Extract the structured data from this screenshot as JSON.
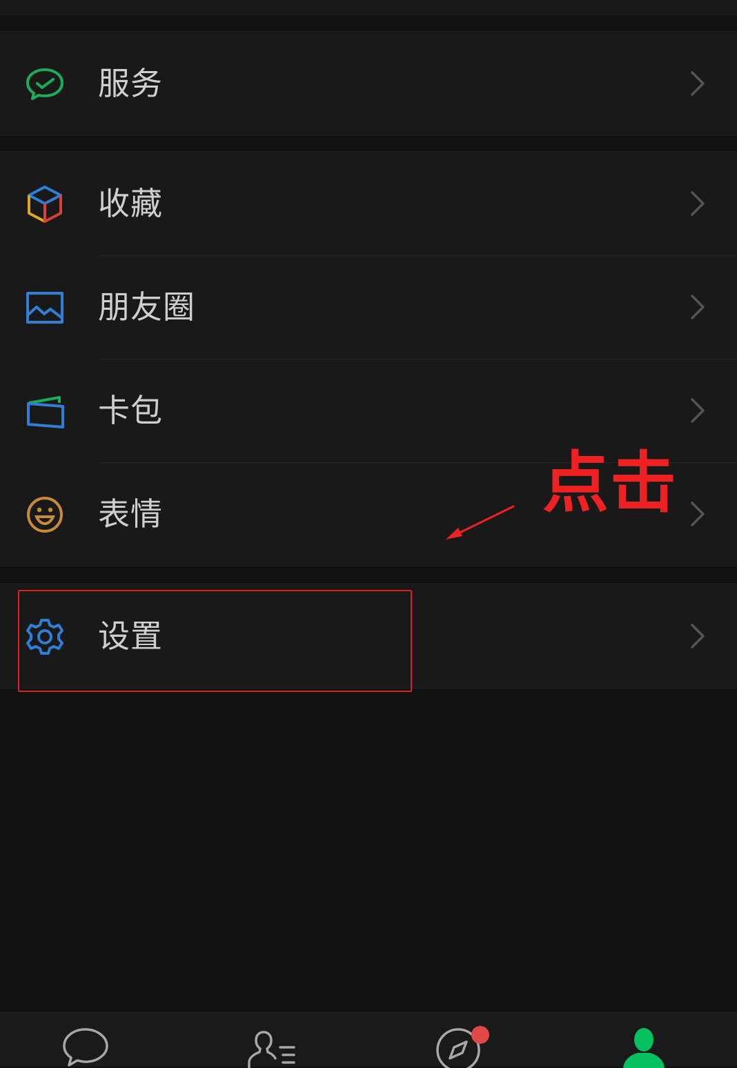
{
  "menu": {
    "services": {
      "label": "服务",
      "icon": "wechat-pay-icon"
    },
    "favorites": {
      "label": "收藏",
      "icon": "cube-icon"
    },
    "moments": {
      "label": "朋友圈",
      "icon": "picture-icon"
    },
    "cards": {
      "label": "卡包",
      "icon": "wallet-icon"
    },
    "stickers": {
      "label": "表情",
      "icon": "smiley-icon"
    },
    "settings": {
      "label": "设置",
      "icon": "gear-icon"
    }
  },
  "annotation": {
    "text": "点击",
    "color": "#ee2222"
  },
  "tabbar": {
    "tabs": [
      {
        "name": "chats",
        "icon": "chat-bubble-icon",
        "active": false
      },
      {
        "name": "contacts",
        "icon": "contacts-icon",
        "active": false
      },
      {
        "name": "discover",
        "icon": "compass-icon",
        "active": false,
        "badge": true
      },
      {
        "name": "me",
        "icon": "person-icon",
        "active": true
      }
    ]
  },
  "colors": {
    "background": "#111111",
    "row": "#191919",
    "text": "#cfcfcf",
    "active_green": "#07c160",
    "badge_red": "#e04848"
  }
}
